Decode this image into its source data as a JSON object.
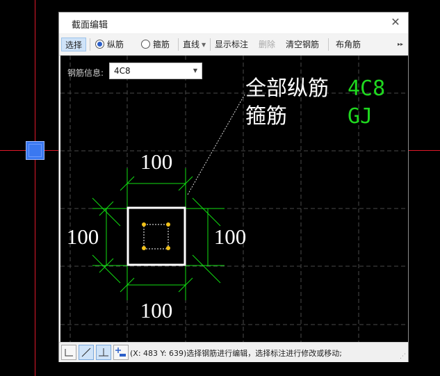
{
  "dialog": {
    "title": "截面编辑"
  },
  "toolbar": {
    "select_label": "选择",
    "longitudinal_label": "纵筋",
    "stirrup_label": "箍筋",
    "line_mode_label": "直线",
    "show_dims_label": "显示标注",
    "delete_label": "删除",
    "clear_rebar_label": "清空钢筋",
    "corner_rebar_label": "布角筋",
    "more_label": "▸▸"
  },
  "canvas": {
    "rebar_info_label": "钢筋信息:",
    "rebar_info_value": "4C8",
    "legend": {
      "all_longitudinal_label": "全部纵筋",
      "all_longitudinal_value": "4C8",
      "stirrup_label": "箍筋",
      "stirrup_value": "GJ"
    },
    "dims": {
      "top": "100",
      "bottom": "100",
      "left": "100",
      "right": "100"
    }
  },
  "status": {
    "message": "(X: 483 Y: 639)选择钢筋进行编辑，选择标注进行修改或移动;"
  },
  "colors": {
    "dim_green": "#12e012",
    "value_green": "#1fd81f",
    "section_white": "#ffffff",
    "crosshair_red": "#e0182a",
    "rebar_yellow": "#f2c21a"
  }
}
